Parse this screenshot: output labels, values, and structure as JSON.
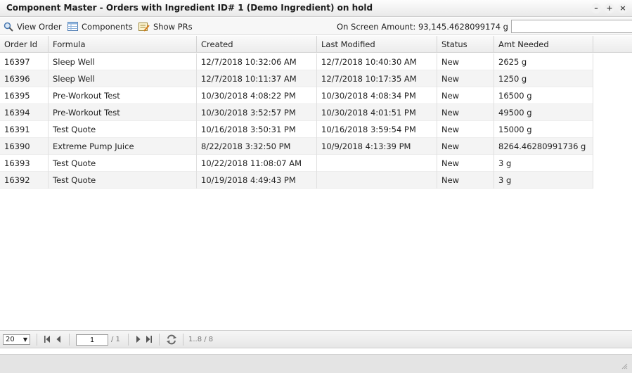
{
  "window": {
    "title": "Component Master - Orders with Ingredient ID# 1 (Demo Ingredient) on hold",
    "controls": {
      "minimize": "–",
      "maximize": "+",
      "close": "×"
    }
  },
  "toolbar": {
    "view_order": "View Order",
    "components": "Components",
    "show_prs": "Show PRs",
    "onscreen_label": "On Screen Amount:",
    "onscreen_value": "93,145.4628099174 g",
    "search_value": ""
  },
  "grid": {
    "columns": [
      "Order Id",
      "Formula",
      "Created",
      "Last Modified",
      "Status",
      "Amt Needed"
    ],
    "rows": [
      [
        "16397",
        "Sleep Well",
        "12/7/2018 10:32:06 AM",
        "12/7/2018 10:40:30 AM",
        "New",
        "2625 g"
      ],
      [
        "16396",
        "Sleep Well",
        "12/7/2018 10:11:37 AM",
        "12/7/2018 10:17:35 AM",
        "New",
        "1250 g"
      ],
      [
        "16395",
        "Pre-Workout Test",
        "10/30/2018 4:08:22 PM",
        "10/30/2018 4:08:34 PM",
        "New",
        "16500 g"
      ],
      [
        "16394",
        "Pre-Workout Test",
        "10/30/2018 3:52:57 PM",
        "10/30/2018 4:01:51 PM",
        "New",
        "49500 g"
      ],
      [
        "16391",
        "Test Quote",
        "10/16/2018 3:50:31 PM",
        "10/16/2018 3:59:54 PM",
        "New",
        "15000 g"
      ],
      [
        "16390",
        "Extreme Pump Juice",
        "8/22/2018 3:32:50 PM",
        "10/9/2018 4:13:39 PM",
        "New",
        "8264.46280991736 g"
      ],
      [
        "16393",
        "Test Quote",
        "10/22/2018 11:08:07 AM",
        "",
        "New",
        "3 g"
      ],
      [
        "16392",
        "Test Quote",
        "10/19/2018 4:49:43 PM",
        "",
        "New",
        "3 g"
      ]
    ]
  },
  "pager": {
    "page_size": "20",
    "page_size_arrow": "▼",
    "current_page": "1",
    "total_pages": "/ 1",
    "range": "1..8 / 8"
  }
}
